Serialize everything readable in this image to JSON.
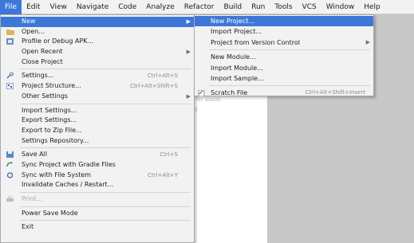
{
  "menubar": {
    "items": [
      {
        "label": "File",
        "active": true
      },
      {
        "label": "Edit"
      },
      {
        "label": "View"
      },
      {
        "label": "Navigate"
      },
      {
        "label": "Code"
      },
      {
        "label": "Analyze"
      },
      {
        "label": "Refactor"
      },
      {
        "label": "Build"
      },
      {
        "label": "Run"
      },
      {
        "label": "Tools"
      },
      {
        "label": "VCS"
      },
      {
        "label": "Window"
      },
      {
        "label": "Help"
      }
    ]
  },
  "file_menu": {
    "new": "New",
    "open": "Open...",
    "profile_debug_apk": "Profile or Debug APK...",
    "open_recent": "Open Recent",
    "close_project": "Close Project",
    "settings": "Settings...",
    "settings_shortcut": "Ctrl+Alt+S",
    "project_structure": "Project Structure...",
    "project_structure_shortcut": "Ctrl+Alt+Shift+S",
    "other_settings": "Other Settings",
    "import_settings": "Import Settings...",
    "export_settings": "Export Settings...",
    "export_to_zip": "Export to Zip File...",
    "settings_repository": "Settings Repository...",
    "save_all": "Save All",
    "save_all_shortcut": "Ctrl+S",
    "sync_gradle": "Sync Project with Gradle Files",
    "sync_file_system": "Sync with File System",
    "sync_file_system_shortcut": "Ctrl+Alt+Y",
    "invalidate_caches": "Invalidate Caches / Restart...",
    "print": "Print...",
    "power_save_mode": "Power Save Mode",
    "exit": "Exit"
  },
  "new_submenu": {
    "new_project": "New Project...",
    "import_project": "Import Project...",
    "project_from_vcs": "Project from Version Control",
    "new_module": "New Module...",
    "import_module": "Import Module...",
    "import_sample": "Import Sample...",
    "scratch_file": "Scratch File",
    "scratch_file_shortcut": "Ctrl+Alt+Shift+Insert"
  },
  "editor": {
    "hint_line1": "ab for assist",
    "hint_line2": "bed"
  },
  "colors": {
    "menu_bg": "#f2f2f2",
    "highlight": "#3d78d8",
    "editor_grey": "#c8c8c8",
    "disabled_text": "#a9a9a9"
  },
  "icons": {
    "open": "folder-icon",
    "profile_debug_apk": "apk-icon",
    "settings": "wrench-icon",
    "project_structure": "project-structure-icon",
    "save_all": "save-icon",
    "sync_gradle": "gradle-sync-icon",
    "sync_file_system": "sync-icon",
    "print": "print-icon",
    "scratch_file": "scratch-file-icon"
  }
}
